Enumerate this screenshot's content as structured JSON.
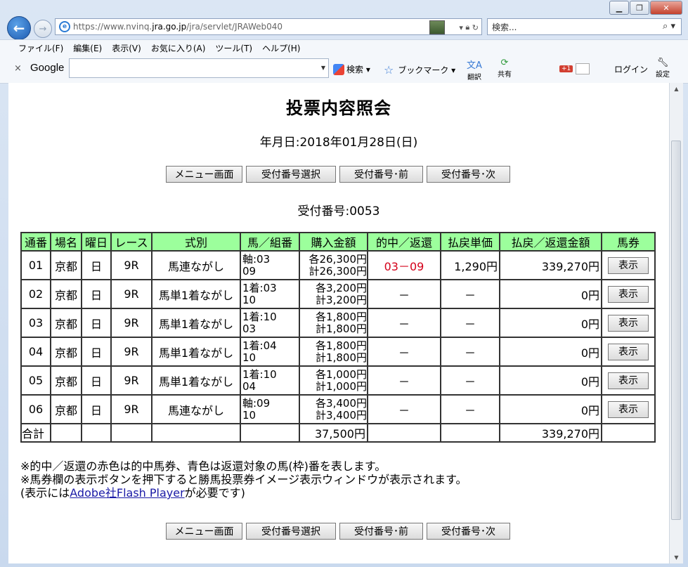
{
  "browser": {
    "tab_title": "投票内容照会",
    "url_prefix": "https://www.nvinq.",
    "url_domain": "jra.go.jp",
    "url_path": "/jra/servlet/JRAWeb040",
    "search_placeholder": "検索...",
    "menu": [
      "ファイル(F)",
      "編集(E)",
      "表示(V)",
      "お気に入り(A)",
      "ツール(T)",
      "ヘルプ(H)"
    ],
    "toolbar": {
      "google_logo": "Google",
      "search_label": "検索",
      "bookmark_label": "ブックマーク",
      "translate_label": "翻訳",
      "share_label": "共有",
      "gplus_badge": "+1",
      "login_label": "ログイン",
      "settings_label": "設定"
    },
    "colors": {
      "accent": "#1d5ab0",
      "header_green": "#9cff9c",
      "hit_red": "#d4001a"
    }
  },
  "page": {
    "title": "投票内容照会",
    "date_line": "年月日:2018年01月28日(日)",
    "receipt_line": "受付番号:0053",
    "buttons": [
      "メニュー画面",
      "受付番号選択",
      "受付番号･前",
      "受付番号･次"
    ]
  },
  "table": {
    "headers": [
      "通番",
      "場名",
      "曜日",
      "レース",
      "式別",
      "馬／組番",
      "購入金額",
      "的中／返還",
      "払戻単価",
      "払戻／返還金額",
      "馬券"
    ],
    "rows": [
      {
        "no": "01",
        "venue": "京都",
        "day": "日",
        "race": "9R",
        "type": "馬連ながし",
        "combo_1": "軸:03",
        "combo_2": "09",
        "amt_each": "各26,300円",
        "amt_total": "計26,300円",
        "hit": "03－09",
        "unit_pay": "1,290円",
        "payout": "339,270円",
        "ticket_btn": "表示"
      },
      {
        "no": "02",
        "venue": "京都",
        "day": "日",
        "race": "9R",
        "type": "馬単1着ながし",
        "combo_1": "1着:03",
        "combo_2": "10",
        "amt_each": "各3,200円",
        "amt_total": "計3,200円",
        "hit": "－",
        "unit_pay": "－",
        "payout": "0円",
        "ticket_btn": "表示"
      },
      {
        "no": "03",
        "venue": "京都",
        "day": "日",
        "race": "9R",
        "type": "馬単1着ながし",
        "combo_1": "1着:10",
        "combo_2": "03",
        "amt_each": "各1,800円",
        "amt_total": "計1,800円",
        "hit": "－",
        "unit_pay": "－",
        "payout": "0円",
        "ticket_btn": "表示"
      },
      {
        "no": "04",
        "venue": "京都",
        "day": "日",
        "race": "9R",
        "type": "馬単1着ながし",
        "combo_1": "1着:04",
        "combo_2": "10",
        "amt_each": "各1,800円",
        "amt_total": "計1,800円",
        "hit": "－",
        "unit_pay": "－",
        "payout": "0円",
        "ticket_btn": "表示"
      },
      {
        "no": "05",
        "venue": "京都",
        "day": "日",
        "race": "9R",
        "type": "馬単1着ながし",
        "combo_1": "1着:10",
        "combo_2": "04",
        "amt_each": "各1,000円",
        "amt_total": "計1,000円",
        "hit": "－",
        "unit_pay": "－",
        "payout": "0円",
        "ticket_btn": "表示"
      },
      {
        "no": "06",
        "venue": "京都",
        "day": "日",
        "race": "9R",
        "type": "馬連ながし",
        "combo_1": "軸:09",
        "combo_2": "10",
        "amt_each": "各3,400円",
        "amt_total": "計3,400円",
        "hit": "－",
        "unit_pay": "－",
        "payout": "0円",
        "ticket_btn": "表示"
      }
    ],
    "total_label": "合計",
    "total_amount": "37,500円",
    "total_payout": "339,270円"
  },
  "notes": {
    "line1": "※的中／返還の赤色は的中馬券、青色は返還対象の馬(枠)番を表します。",
    "line2": "※馬券欄の表示ボタンを押下すると勝馬投票券イメージ表示ウィンドウが表示されます。",
    "line3_prefix": "(表示には",
    "line3_link": "Adobe社Flash Player",
    "line3_suffix": "が必要です)"
  }
}
